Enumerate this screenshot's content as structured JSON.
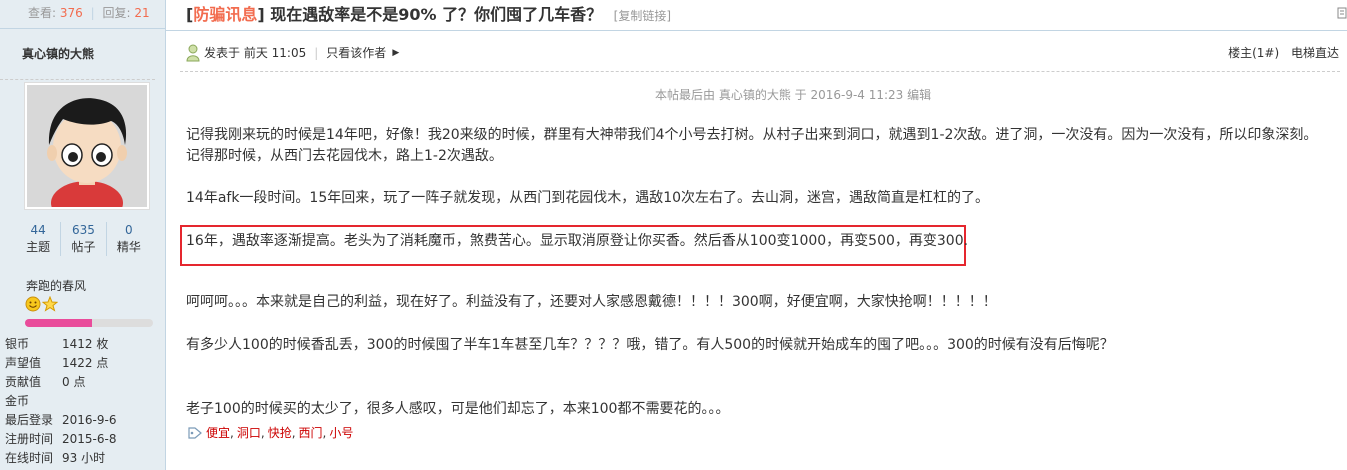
{
  "sidebar": {
    "views_label": "查看:",
    "views": "376",
    "replies_label": "回复:",
    "replies": "21",
    "author": "真心镇的大熊",
    "counts": [
      {
        "value": "44",
        "label": "主题"
      },
      {
        "value": "635",
        "label": "帖子"
      },
      {
        "value": "0",
        "label": "精华"
      }
    ],
    "usergroup": "奔跑的春风",
    "progress": 0.52,
    "info": [
      {
        "key": "银币",
        "value": "1412 枚"
      },
      {
        "key": "声望值",
        "value": "1422 点"
      },
      {
        "key": "贡献值",
        "value": "0 点"
      },
      {
        "key": "金币",
        "value": ""
      },
      {
        "key": "最后登录",
        "value": "2016-9-6"
      },
      {
        "key": "注册时间",
        "value": "2015-6-8"
      },
      {
        "key": "在线时间",
        "value": "93 小时"
      }
    ]
  },
  "thread": {
    "category_open": "[",
    "category": "防骗讯息",
    "category_close": "]",
    "title": "现在遇敌率是不是90% 了？你们囤了几车香？",
    "copy_link": "[复制链接]"
  },
  "post": {
    "posted_prefix": "发表于",
    "posted_time": "前天 11:05",
    "only_author": "只看该作者",
    "floor": "楼主(1#)",
    "elevator": "电梯直达",
    "edit_note": "本帖最后由 真心镇的大熊 于 2016-9-4 11:23 编辑",
    "paragraphs": [
      "记得我刚来玩的时候是14年吧，好像！我20来级的时候，群里有大神带我们4个小号去打树。从村子出来到洞口，就遇到1-2次敌。进了洞，一次没有。因为一次没有，所以印象深刻。",
      "记得那时候，从西门去花园伐木，路上1-2次遇敌。",
      "14年afk一段时间。15年回来，玩了一阵子就发现，从西门到花园伐木，遇敌10次左右了。去山洞，迷宫，遇敌简直是杠杠的了。",
      "16年，遇敌率逐渐提高。老头为了消耗魔币，煞费苦心。显示取消原登让你买香。然后香从100变1000，再变500，再变300.",
      "呵呵呵。。。本来就是自己的利益，现在好了。利益没有了，还要对人家感恩戴德！！！！300啊，好便宜啊，大家快抢啊！！！！！",
      "有多少人100的时候香乱丢，300的时候囤了半车1车甚至几车？？？？哦，错了。有人500的时候就开始成车的囤了吧。。。300的时候有没有后悔呢？",
      "老子100的时候买的太少了，很多人感叹，可是他们却忘了，本来100都不需要花的。。。"
    ],
    "tags": [
      "便宜",
      "洞口",
      "快抢",
      "西门",
      "小号"
    ]
  }
}
